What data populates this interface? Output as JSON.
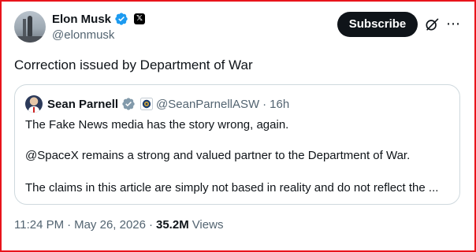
{
  "author": {
    "display_name": "Elon Musk",
    "handle": "@elonmusk",
    "verified_badge_icon": "verified-badge-icon",
    "affiliate_icon": "x-logo-icon",
    "affiliate_glyph": "𝕏"
  },
  "actions": {
    "subscribe_label": "Subscribe",
    "grok_icon": "grok-icon",
    "more_glyph": "⋯"
  },
  "tweet": {
    "text": "Correction issued by Department of War"
  },
  "quote": {
    "display_name": "Sean Parnell",
    "handle": "@SeanParnellASW",
    "separator": "·",
    "time": "16h",
    "lines": [
      "The Fake News media has the story wrong, again.",
      "@SpaceX remains a strong and valued partner to the Department of War.",
      "The claims in this article are simply not based in reality and do not reflect the ..."
    ]
  },
  "meta": {
    "time": "11:24 PM",
    "separator": "·",
    "date": "May 26, 2026",
    "views_count": "35.2M",
    "views_label": "Views"
  },
  "colors": {
    "accent_blue": "#1d9bf0",
    "text_primary": "#0f1419",
    "text_secondary": "#536471",
    "border": "#cfd9de",
    "frame_red": "#e8141b"
  }
}
